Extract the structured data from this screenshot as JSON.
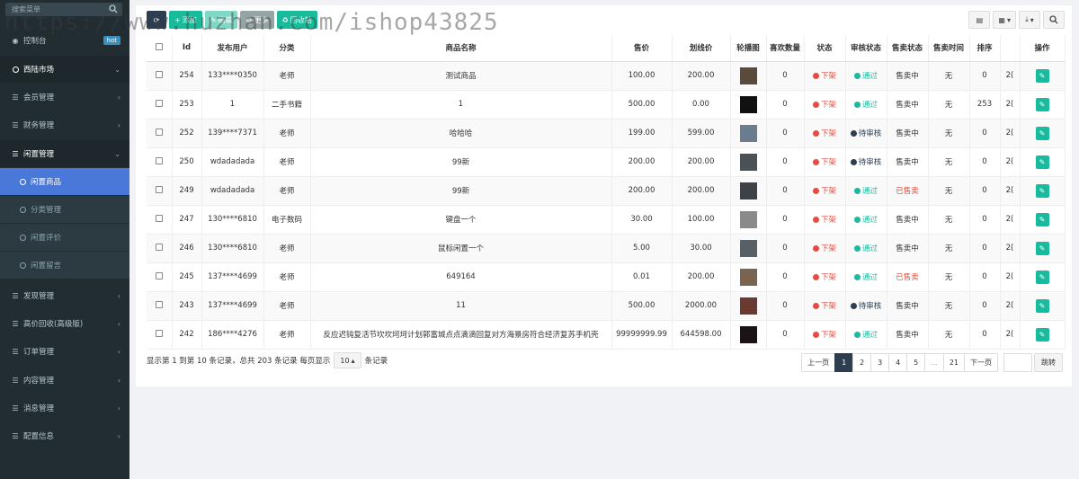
{
  "sidebar": {
    "search_placeholder": "搜索菜单",
    "items": [
      {
        "label": "控制台",
        "badge": "hot"
      },
      {
        "label": "西陆市场"
      },
      {
        "label": "会员管理"
      },
      {
        "label": "财务管理"
      },
      {
        "label": "闲置管理"
      },
      {
        "label": "闲置商品"
      },
      {
        "label": "分类管理"
      },
      {
        "label": "闲置评价"
      },
      {
        "label": "闲置留言"
      },
      {
        "label": "发现管理"
      },
      {
        "label": "高价回收(高级版)"
      },
      {
        "label": "订单管理"
      },
      {
        "label": "内容管理"
      },
      {
        "label": "消息管理"
      },
      {
        "label": "配置信息"
      }
    ]
  },
  "watermark": "https://www.huzhan.com/ishop43825",
  "toolbar": {
    "add": "添加",
    "edit": "编辑",
    "more": "更多",
    "recycle": "回收站"
  },
  "table": {
    "headers": [
      "Id",
      "发布用户",
      "分类",
      "商品名称",
      "售价",
      "划线价",
      "轮播图",
      "喜欢数量",
      "状态",
      "审核状态",
      "售卖状态",
      "售卖时间",
      "排序",
      "",
      "操作"
    ],
    "rows": [
      {
        "id": "254",
        "user": "133****0350",
        "cat": "老师",
        "name": "测试商品",
        "price": "100.00",
        "orig": "200.00",
        "likes": "0",
        "status": "下架",
        "audit": "通过",
        "sale": "售卖中",
        "time": "无",
        "sort": "0",
        "extra": "2("
      },
      {
        "id": "253",
        "user": "1",
        "cat": "二手书籍",
        "name": "1",
        "price": "500.00",
        "orig": "0.00",
        "likes": "0",
        "status": "下架",
        "audit": "通过",
        "sale": "售卖中",
        "time": "无",
        "sort": "253",
        "extra": "2("
      },
      {
        "id": "252",
        "user": "139****7371",
        "cat": "老师",
        "name": "哈哈哈",
        "price": "199.00",
        "orig": "599.00",
        "likes": "0",
        "status": "下架",
        "audit": "待审核",
        "sale": "售卖中",
        "time": "无",
        "sort": "0",
        "extra": "2("
      },
      {
        "id": "250",
        "user": "wdadadada",
        "cat": "老师",
        "name": "99新",
        "price": "200.00",
        "orig": "200.00",
        "likes": "0",
        "status": "下架",
        "audit": "待审核",
        "sale": "售卖中",
        "time": "无",
        "sort": "0",
        "extra": "2("
      },
      {
        "id": "249",
        "user": "wdadadada",
        "cat": "老师",
        "name": "99新",
        "price": "200.00",
        "orig": "200.00",
        "likes": "0",
        "status": "下架",
        "audit": "通过",
        "sale": "已售卖",
        "time": "无",
        "sort": "0",
        "extra": "2("
      },
      {
        "id": "247",
        "user": "130****6810",
        "cat": "电子数码",
        "name": "键盘一个",
        "price": "30.00",
        "orig": "100.00",
        "likes": "0",
        "status": "下架",
        "audit": "通过",
        "sale": "售卖中",
        "time": "无",
        "sort": "0",
        "extra": "2("
      },
      {
        "id": "246",
        "user": "130****6810",
        "cat": "老师",
        "name": "鼠标闲置一个",
        "price": "5.00",
        "orig": "30.00",
        "likes": "0",
        "status": "下架",
        "audit": "通过",
        "sale": "售卖中",
        "time": "无",
        "sort": "0",
        "extra": "2("
      },
      {
        "id": "245",
        "user": "137****4699",
        "cat": "老师",
        "name": "649164",
        "price": "0.01",
        "orig": "200.00",
        "likes": "0",
        "status": "下架",
        "audit": "通过",
        "sale": "已售卖",
        "time": "无",
        "sort": "0",
        "extra": "2("
      },
      {
        "id": "243",
        "user": "137****4699",
        "cat": "老师",
        "name": "11",
        "price": "500.00",
        "orig": "2000.00",
        "likes": "0",
        "status": "下架",
        "audit": "待审核",
        "sale": "售卖中",
        "time": "无",
        "sort": "0",
        "extra": "2("
      },
      {
        "id": "242",
        "user": "186****4276",
        "cat": "老师",
        "name": "反应迟钝复活节坎坎坷坷计划郭富城点点滴滴回复对方海景房符合经济复苏手机壳",
        "price": "99999999.99",
        "orig": "644598.00",
        "likes": "0",
        "status": "下架",
        "audit": "通过",
        "sale": "售卖中",
        "time": "无",
        "sort": "0",
        "extra": "2("
      }
    ]
  },
  "footer": {
    "info_prefix": "显示第 1 到第 10 条记录，总共 203 条记录 每页显示",
    "page_size": "10",
    "info_suffix": "条记录"
  },
  "pager": {
    "prev": "上一页",
    "pages": [
      "1",
      "2",
      "3",
      "4",
      "5",
      "...",
      "21"
    ],
    "next": "下一页",
    "jump": "跳转"
  },
  "colors": {
    "red": "#e74c3c",
    "green": "#18bc9c",
    "navy": "#2c3e50",
    "sidebar_bg": "#222d32",
    "active_blue": "#4a78d8"
  }
}
